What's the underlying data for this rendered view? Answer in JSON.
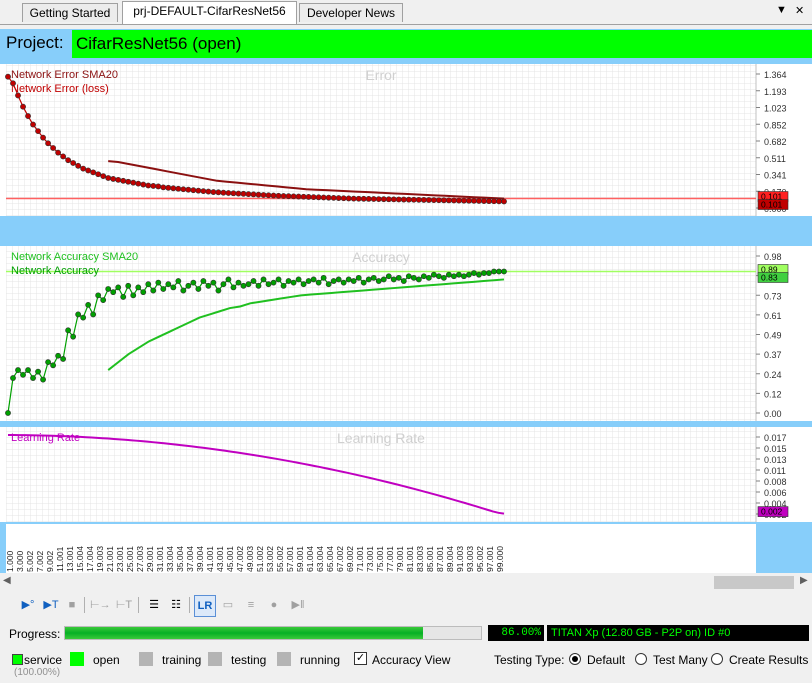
{
  "tabs": [
    {
      "label": "Getting Started",
      "active": false
    },
    {
      "label": "prj-DEFAULT-CifarResNet56",
      "active": true
    },
    {
      "label": "Developer News",
      "active": false
    }
  ],
  "tab_controls": {
    "dropdown": "▼",
    "close": "✕"
  },
  "project": {
    "label": "Project:",
    "name": "CifarResNet56 (open)",
    "accent": "#00ff00"
  },
  "chart_data": [
    {
      "type": "line",
      "title": "Error",
      "series": [
        {
          "name": "Network Error SMA20",
          "color": "#8b1010",
          "x_start": 20,
          "values": [
            0.5,
            0.49,
            0.47,
            0.45,
            0.43,
            0.41,
            0.39,
            0.37,
            0.35,
            0.33,
            0.31,
            0.29,
            0.28,
            0.27,
            0.26,
            0.25,
            0.24,
            0.23,
            0.22,
            0.21,
            0.2,
            0.195,
            0.19,
            0.185,
            0.18,
            0.175,
            0.17,
            0.165,
            0.16,
            0.155,
            0.15,
            0.145,
            0.14,
            0.135,
            0.13,
            0.125,
            0.12,
            0.115,
            0.11,
            0.105,
            0.1
          ]
        },
        {
          "name": "Network Error (loss)",
          "color": "#c00000",
          "values": [
            1.4,
            1.33,
            1.2,
            1.08,
            0.98,
            0.89,
            0.82,
            0.75,
            0.69,
            0.64,
            0.59,
            0.55,
            0.51,
            0.48,
            0.45,
            0.42,
            0.4,
            0.38,
            0.36,
            0.34,
            0.32,
            0.31,
            0.3,
            0.29,
            0.28,
            0.27,
            0.26,
            0.25,
            0.24,
            0.235,
            0.23,
            0.22,
            0.215,
            0.21,
            0.205,
            0.2,
            0.195,
            0.19,
            0.185,
            0.18,
            0.175,
            0.17,
            0.167,
            0.163,
            0.16,
            0.157,
            0.154,
            0.151,
            0.148,
            0.145,
            0.142,
            0.139,
            0.136,
            0.133,
            0.13,
            0.128,
            0.126,
            0.124,
            0.122,
            0.12,
            0.118,
            0.116,
            0.114,
            0.112,
            0.11,
            0.108,
            0.106,
            0.104,
            0.102,
            0.1,
            0.099,
            0.098,
            0.097,
            0.096,
            0.095,
            0.094,
            0.093,
            0.092,
            0.091,
            0.09,
            0.089,
            0.088,
            0.087,
            0.086,
            0.085,
            0.084,
            0.083,
            0.082,
            0.081,
            0.08,
            0.079,
            0.078,
            0.077,
            0.076,
            0.075,
            0.074,
            0.073,
            0.072,
            0.071,
            0.07
          ]
        }
      ],
      "reference_line": 0.101,
      "ylim": [
        0,
        1.45
      ],
      "ticks": [
        "1.364",
        "1.193",
        "1.023",
        "0.852",
        "0.682",
        "0.511",
        "0.341",
        "0.170",
        "0.000"
      ],
      "badges": [
        {
          "text": "0.101",
          "color": "#ff2020"
        },
        {
          "text": "0.101",
          "color": "#c00000"
        }
      ]
    },
    {
      "type": "line",
      "title": "Accuracy",
      "series": [
        {
          "name": "Network Accuracy SMA20",
          "color": "#20c020",
          "x_start": 20,
          "values": [
            0.27,
            0.32,
            0.37,
            0.41,
            0.45,
            0.48,
            0.51,
            0.54,
            0.57,
            0.6,
            0.62,
            0.64,
            0.66,
            0.67,
            0.69,
            0.7,
            0.71,
            0.72,
            0.73,
            0.74,
            0.745,
            0.75,
            0.755,
            0.76,
            0.765,
            0.77,
            0.775,
            0.78,
            0.785,
            0.79,
            0.795,
            0.8,
            0.805,
            0.81,
            0.815,
            0.82,
            0.825,
            0.83,
            0.835,
            0.84
          ]
        },
        {
          "name": "Network Accuracy",
          "color": "#00a000",
          "values": [
            0.0,
            0.22,
            0.27,
            0.24,
            0.27,
            0.22,
            0.26,
            0.21,
            0.32,
            0.3,
            0.36,
            0.34,
            0.52,
            0.48,
            0.62,
            0.6,
            0.68,
            0.62,
            0.74,
            0.71,
            0.78,
            0.76,
            0.79,
            0.73,
            0.8,
            0.74,
            0.79,
            0.76,
            0.81,
            0.77,
            0.82,
            0.78,
            0.81,
            0.79,
            0.83,
            0.77,
            0.8,
            0.82,
            0.78,
            0.83,
            0.8,
            0.82,
            0.77,
            0.81,
            0.84,
            0.79,
            0.82,
            0.8,
            0.81,
            0.83,
            0.8,
            0.84,
            0.81,
            0.82,
            0.84,
            0.8,
            0.83,
            0.82,
            0.84,
            0.81,
            0.83,
            0.84,
            0.82,
            0.85,
            0.81,
            0.83,
            0.84,
            0.82,
            0.84,
            0.83,
            0.85,
            0.82,
            0.84,
            0.85,
            0.83,
            0.84,
            0.86,
            0.84,
            0.85,
            0.83,
            0.86,
            0.85,
            0.84,
            0.86,
            0.85,
            0.87,
            0.86,
            0.85,
            0.87,
            0.86,
            0.87,
            0.86,
            0.87,
            0.88,
            0.87,
            0.88,
            0.88,
            0.89,
            0.89,
            0.89
          ]
        }
      ],
      "reference_line": 0.89,
      "ylim": [
        0,
        1.0
      ],
      "ticks": [
        "0.98",
        "0.86",
        "0.73",
        "0.61",
        "0.49",
        "0.37",
        "0.24",
        "0.12",
        "0.00"
      ],
      "badges": [
        {
          "text": "0.89",
          "color": "#a0ff60"
        },
        {
          "text": "0.83",
          "color": "#40d040"
        }
      ]
    },
    {
      "type": "line",
      "title": "Learning Rate",
      "series": [
        {
          "name": "Learning Rate",
          "color": "#c000c0",
          "values": [
            0.02,
            0.01999,
            0.01998,
            0.01996,
            0.01994,
            0.01991,
            0.01988,
            0.01984,
            0.0198,
            0.01975,
            0.0197,
            0.01964,
            0.01958,
            0.01951,
            0.01944,
            0.01936,
            0.01928,
            0.01919,
            0.0191,
            0.019,
            0.0189,
            0.01879,
            0.01868,
            0.01856,
            0.01844,
            0.01831,
            0.01818,
            0.01804,
            0.0179,
            0.01775,
            0.0176,
            0.01744,
            0.01728,
            0.01711,
            0.01694,
            0.01676,
            0.01658,
            0.01639,
            0.0162,
            0.016,
            0.0158,
            0.01559,
            0.01538,
            0.01516,
            0.01494,
            0.01471,
            0.01448,
            0.01424,
            0.014,
            0.01375,
            0.0135,
            0.01324,
            0.01298,
            0.01271,
            0.01244,
            0.01216,
            0.01188,
            0.01159,
            0.0113,
            0.011,
            0.0107,
            0.01039,
            0.01008,
            0.00976,
            0.00944,
            0.00911,
            0.00878,
            0.00844,
            0.0081,
            0.00775,
            0.0074,
            0.00704,
            0.00668,
            0.00631,
            0.00594,
            0.00556,
            0.00518,
            0.00479,
            0.0044,
            0.004,
            0.0036,
            0.00319,
            0.00278,
            0.00236,
            0.00194,
            0.00151,
            0.00108,
            0.00065,
            0.0003,
            0.0001
          ]
        }
      ],
      "ylim": [
        0,
        0.02
      ],
      "ticks": [
        "0.017",
        "0.015",
        "0.013",
        "0.011",
        "0.008",
        "0.006",
        "0.004",
        "0.002"
      ],
      "badges": [
        {
          "text": "0.002",
          "color": "#c000c0"
        }
      ]
    }
  ],
  "x_ticks": [
    "1.000",
    "3.000",
    "5.002",
    "7.002",
    "9.002",
    "11.001",
    "13.001",
    "15.004",
    "17.004",
    "19.003",
    "21.001",
    "23.001",
    "25.001",
    "27.003",
    "29.001",
    "31.001",
    "33.004",
    "35.004",
    "37.004",
    "39.004",
    "41.001",
    "43.001",
    "45.001",
    "47.002",
    "49.003",
    "51.002",
    "53.002",
    "55.002",
    "57.001",
    "59.001",
    "61.004",
    "63.004",
    "65.004",
    "67.002",
    "69.002",
    "71.001",
    "73.001",
    "75.001",
    "77.001",
    "79.001",
    "81.001",
    "83.003",
    "85.001",
    "87.001",
    "89.004",
    "91.003",
    "93.003",
    "95.002",
    "97.001",
    "99.000"
  ],
  "scroll": {
    "left": "◀",
    "right": "▶"
  },
  "toolbar": [
    {
      "name": "open-model-icon",
      "glyph": "▶°",
      "enabled": true
    },
    {
      "name": "train-icon",
      "glyph": "▶T",
      "enabled": true
    },
    {
      "name": "stop-icon",
      "glyph": "■",
      "enabled": false
    },
    {
      "name": "step-forward-icon",
      "glyph": "⊢→",
      "enabled": false
    },
    {
      "name": "step-test-icon",
      "glyph": "⊢T",
      "enabled": false
    },
    {
      "name": "layers-icon",
      "glyph": "☰",
      "enabled": true
    },
    {
      "name": "weights-icon",
      "glyph": "☷",
      "enabled": true
    },
    {
      "name": "learning-rate-icon",
      "glyph": "LR",
      "enabled": true
    },
    {
      "name": "clear-icon",
      "glyph": "▭",
      "enabled": false
    },
    {
      "name": "list-icon",
      "glyph": "≡",
      "enabled": false
    },
    {
      "name": "nan-icon",
      "glyph": "●",
      "enabled": false
    },
    {
      "name": "pause-icon",
      "glyph": "▶‖",
      "enabled": false
    }
  ],
  "progress": {
    "label": "Progress:",
    "value_text": "86.00%",
    "fraction": 0.86,
    "gpu": "TITAN Xp (12.80 GB - P2P on) ID #0"
  },
  "status": {
    "service": "service",
    "service_pct": "(100.00%)",
    "open": "open",
    "training": "training",
    "testing": "testing",
    "running": "running",
    "accuracy_view": "Accuracy View",
    "testing_type": "Testing Type:",
    "radio_default": "Default",
    "radio_test_many": "Test Many",
    "radio_create_results": "Create Results",
    "open_color": "#00ff00",
    "idle_color": "#b4b4b4"
  }
}
